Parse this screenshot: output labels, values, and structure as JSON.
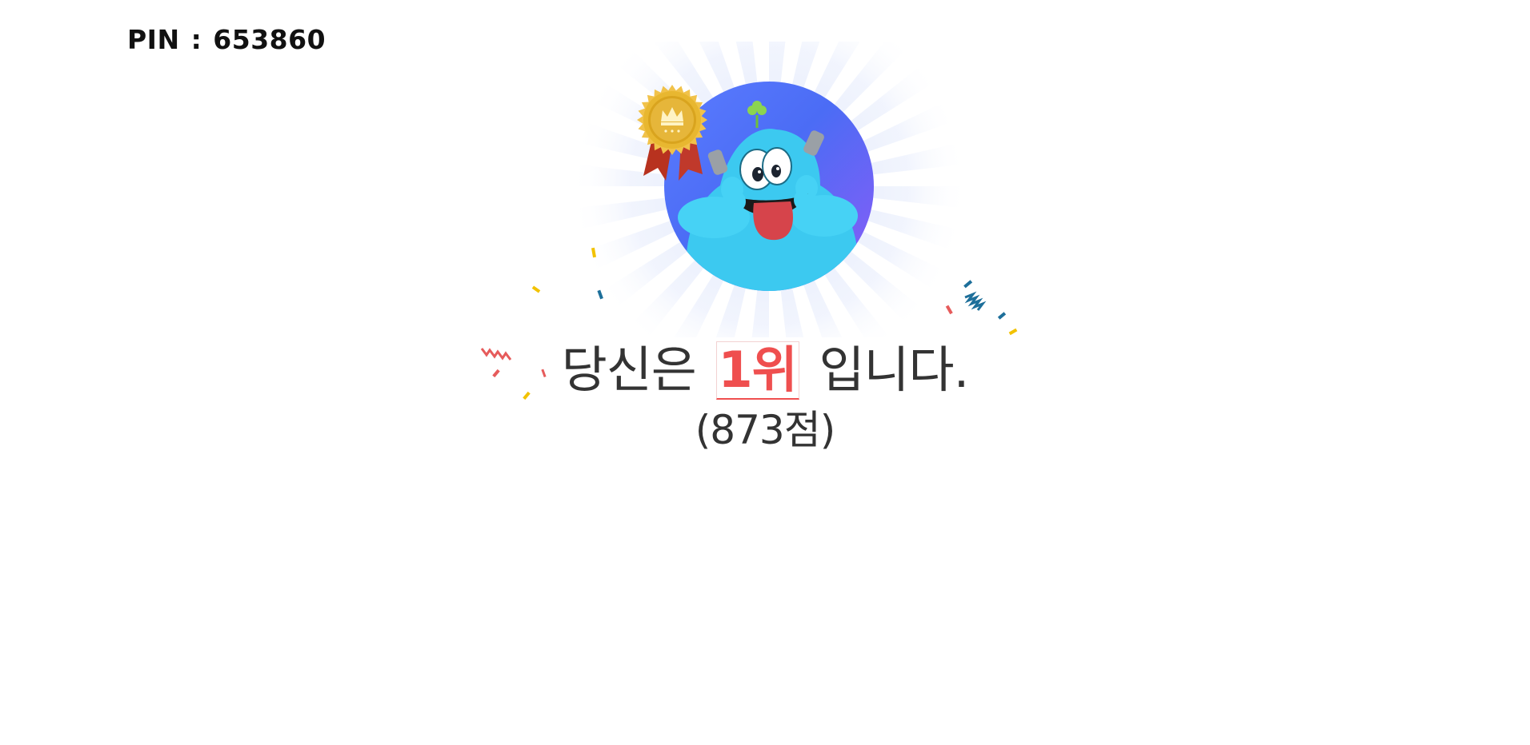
{
  "header": {
    "pin_label": "PIN",
    "pin_separator": ":",
    "pin_value": "653860"
  },
  "result": {
    "prefix": "당신은",
    "rank": "1위",
    "suffix": "입니다.",
    "score": "(873점)"
  },
  "colors": {
    "rank": "#ef4f4f",
    "text": "#333333",
    "circle_start": "#4b6cf5",
    "circle_end": "#8b5cf6",
    "monster": "#3cc9f0",
    "tongue": "#d6444b",
    "medal_gold": "#e8b730",
    "ribbon": "#c0392b"
  },
  "icons": {
    "medal": "gold-medal-crown-icon",
    "character": "blue-monster-character",
    "confetti": "confetti-decoration"
  }
}
